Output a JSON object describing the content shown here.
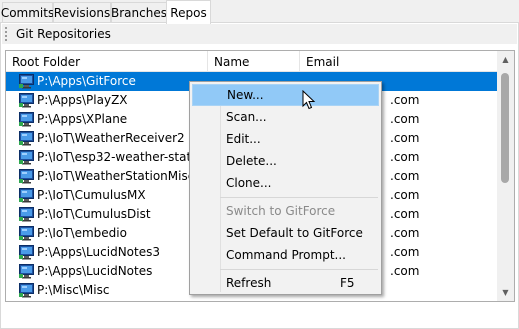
{
  "tabs": [
    "Commits",
    "Revisions",
    "Branches",
    "Repos"
  ],
  "toolbar": {
    "title": "Git Repositories"
  },
  "list": {
    "columns": [
      "Root Folder",
      "Name",
      "Email"
    ],
    "rows": [
      {
        "folder": "P:\\Apps\\GitForce",
        "name": "",
        "email": ""
      },
      {
        "folder": "P:\\Apps\\PlayZX",
        "name": "",
        "email": ".com"
      },
      {
        "folder": "P:\\Apps\\XPlane",
        "name": "",
        "email": ".com"
      },
      {
        "folder": "P:\\IoT\\WeatherReceiver2",
        "name": "",
        "email": ".com"
      },
      {
        "folder": "P:\\IoT\\esp32-weather-station",
        "name": "",
        "email": ".com"
      },
      {
        "folder": "P:\\IoT\\WeatherStationMisc",
        "name": "",
        "email": ".com"
      },
      {
        "folder": "P:\\IoT\\CumulusMX",
        "name": "",
        "email": ".com"
      },
      {
        "folder": "P:\\IoT\\CumulusDist",
        "name": "",
        "email": ".com"
      },
      {
        "folder": "P:\\IoT\\embedio",
        "name": "",
        "email": ".com"
      },
      {
        "folder": "P:\\Apps\\LucidNotes3",
        "name": "",
        "email": ".com"
      },
      {
        "folder": "P:\\Apps\\LucidNotes",
        "name": "",
        "email": ".com"
      },
      {
        "folder": "P:\\Misc\\Misc",
        "name": "",
        "email": ""
      }
    ]
  },
  "context_menu": {
    "items": [
      {
        "label": "New...",
        "shortcut": "",
        "state": "hover"
      },
      {
        "label": "Scan...",
        "shortcut": "",
        "state": "normal"
      },
      {
        "label": "Edit...",
        "shortcut": "",
        "state": "normal"
      },
      {
        "label": "Delete...",
        "shortcut": "",
        "state": "normal"
      },
      {
        "label": "Clone...",
        "shortcut": "",
        "state": "normal"
      },
      {
        "label": "Switch to GitForce",
        "shortcut": "",
        "state": "disabled"
      },
      {
        "label": "Set Default to GitForce",
        "shortcut": "",
        "state": "normal"
      },
      {
        "label": "Command Prompt...",
        "shortcut": "",
        "state": "normal"
      },
      {
        "label": "Refresh",
        "shortcut": "F5",
        "state": "normal"
      }
    ]
  },
  "colors": {
    "selection": "#0078d7",
    "menu_hover": "#91c9f7"
  },
  "icons": {
    "repo": "computer-icon",
    "cursor": "mouse-pointer-icon"
  }
}
